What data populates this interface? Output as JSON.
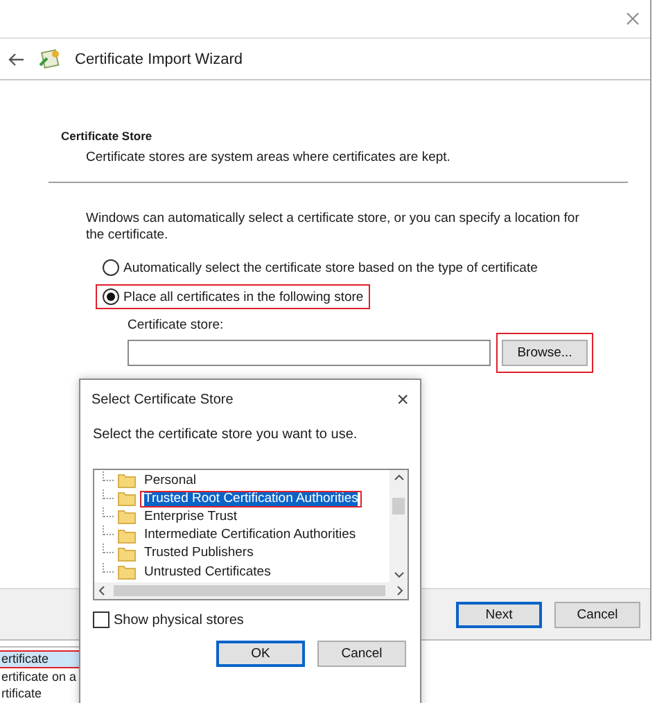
{
  "wizard": {
    "title": "Certificate Import Wizard",
    "section_title": "Certificate Store",
    "section_description": "Certificate stores are system areas where certificates are kept.",
    "intro": "Windows can automatically select a certificate store, or you can specify a location for the certificate.",
    "options": [
      {
        "label": "Automatically select the certificate store based on the type of certificate",
        "selected": false,
        "highlighted": false
      },
      {
        "label": "Place all certificates in the following store",
        "selected": true,
        "highlighted": true
      }
    ],
    "store_label": "Certificate store:",
    "browse": {
      "label": "Browse...",
      "highlighted": true
    },
    "buttons": [
      {
        "label": "Next",
        "default": true
      },
      {
        "label": "Cancel",
        "default": false
      }
    ]
  },
  "dialog": {
    "title": "Select Certificate Store",
    "close": "×",
    "prompt": "Select the certificate store you want to use.",
    "stores": [
      {
        "label": "Personal",
        "selected": false,
        "highlighted": false
      },
      {
        "label": "Trusted Root Certification Authorities",
        "selected": true,
        "highlighted": true
      },
      {
        "label": "Enterprise Trust",
        "selected": false,
        "highlighted": false
      },
      {
        "label": "Intermediate Certification Authorities",
        "selected": false,
        "highlighted": false
      },
      {
        "label": "Trusted Publishers",
        "selected": false,
        "highlighted": false
      },
      {
        "label": "Untrusted Certificates",
        "selected": false,
        "highlighted": false
      }
    ],
    "show_physical_stores": {
      "label": "Show physical stores",
      "checked": false
    },
    "buttons": [
      {
        "label": "OK",
        "default": true
      },
      {
        "label": "Cancel",
        "default": false
      }
    ]
  },
  "background_list": {
    "items": [
      {
        "label": "ertificate",
        "selected": true
      },
      {
        "label": "ertificate on a",
        "selected": false
      },
      {
        "label": "rtificate",
        "selected": false
      }
    ]
  }
}
